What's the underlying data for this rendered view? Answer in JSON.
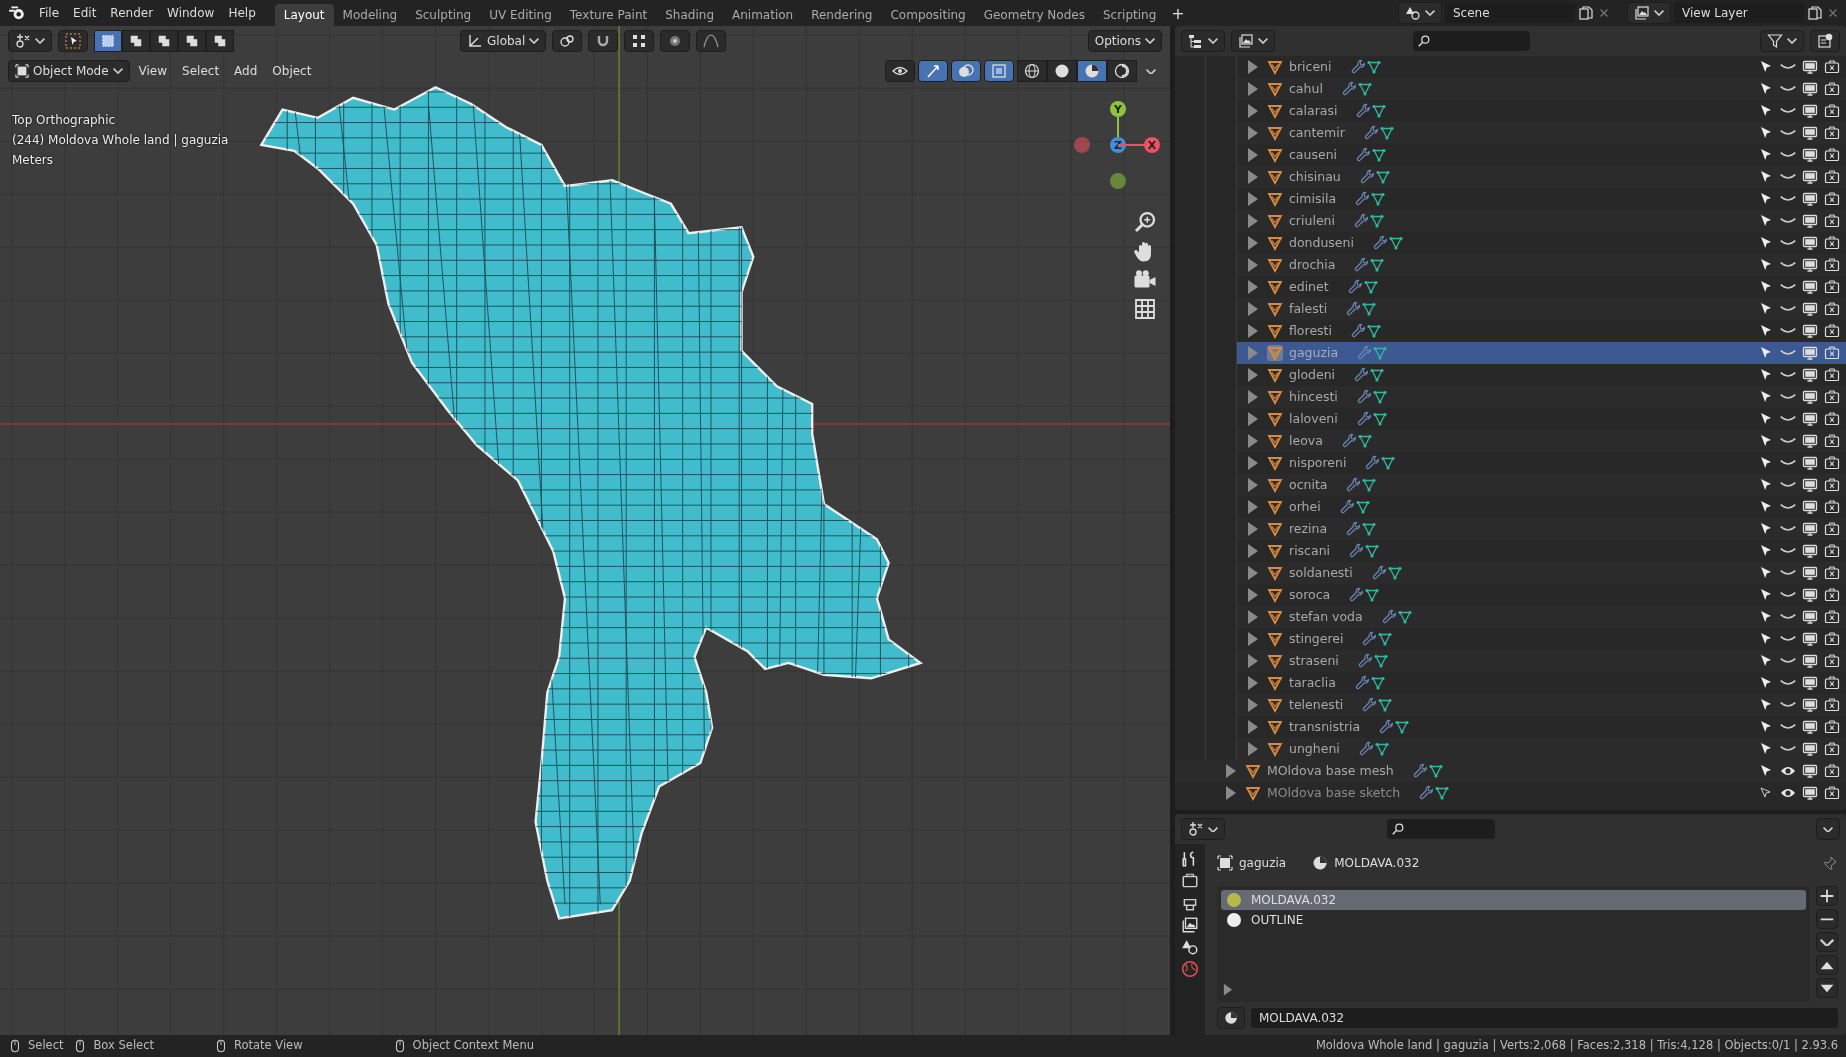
{
  "menu": [
    "File",
    "Edit",
    "Render",
    "Window",
    "Help"
  ],
  "workspaces": [
    {
      "label": "Layout",
      "selected": true
    },
    {
      "label": "Modeling",
      "selected": false
    },
    {
      "label": "Sculpting",
      "selected": false
    },
    {
      "label": "UV Editing",
      "selected": false
    },
    {
      "label": "Texture Paint",
      "selected": false
    },
    {
      "label": "Shading",
      "selected": false
    },
    {
      "label": "Animation",
      "selected": false
    },
    {
      "label": "Rendering",
      "selected": false
    },
    {
      "label": "Compositing",
      "selected": false
    },
    {
      "label": "Geometry Nodes",
      "selected": false
    },
    {
      "label": "Scripting",
      "selected": false
    }
  ],
  "add_workspace": "+",
  "scene": "Scene",
  "view_layer": "View Layer",
  "viewport": {
    "transform_orientation": "Global",
    "options": "Options",
    "mode": "Object Mode",
    "menus": [
      "View",
      "Select",
      "Add",
      "Object"
    ],
    "shading_modes": [
      {
        "kind": "wireframe",
        "selected": false
      },
      {
        "kind": "solid",
        "selected": false
      },
      {
        "kind": "material",
        "selected": true
      },
      {
        "kind": "rendered",
        "selected": false
      }
    ],
    "overlay_text": [
      "Top Orthographic",
      "(244) Moldova Whole land | gaguzia",
      "Meters"
    ],
    "gizmo_axes": [
      {
        "label": "Y",
        "color": "#8cc43d"
      },
      {
        "label": "Z",
        "color": "#3d8fe0"
      },
      {
        "label": "X",
        "color": "#f0505f"
      }
    ]
  },
  "outliner": {
    "collection_rows": [
      {
        "name": "briceni",
        "selected": false,
        "visible": false
      },
      {
        "name": "cahul",
        "selected": false,
        "visible": false
      },
      {
        "name": "calarasi",
        "selected": false,
        "visible": false
      },
      {
        "name": "cantemir",
        "selected": false,
        "visible": false
      },
      {
        "name": "causeni",
        "selected": false,
        "visible": false
      },
      {
        "name": "chisinau",
        "selected": false,
        "visible": false
      },
      {
        "name": "cimisila",
        "selected": false,
        "visible": false
      },
      {
        "name": "criuleni",
        "selected": false,
        "visible": false
      },
      {
        "name": "donduseni",
        "selected": false,
        "visible": false
      },
      {
        "name": "drochia",
        "selected": false,
        "visible": false
      },
      {
        "name": "edinet",
        "selected": false,
        "visible": false
      },
      {
        "name": "falesti",
        "selected": false,
        "visible": false
      },
      {
        "name": "floresti",
        "selected": false,
        "visible": false
      },
      {
        "name": "gaguzia",
        "selected": true,
        "visible": false
      },
      {
        "name": "glodeni",
        "selected": false,
        "visible": false
      },
      {
        "name": "hincesti",
        "selected": false,
        "visible": false
      },
      {
        "name": "laloveni",
        "selected": false,
        "visible": false
      },
      {
        "name": "leova",
        "selected": false,
        "visible": false
      },
      {
        "name": "nisporeni",
        "selected": false,
        "visible": false
      },
      {
        "name": "ocnita",
        "selected": false,
        "visible": false
      },
      {
        "name": "orhei",
        "selected": false,
        "visible": false
      },
      {
        "name": "rezina",
        "selected": false,
        "visible": false
      },
      {
        "name": "riscani",
        "selected": false,
        "visible": false
      },
      {
        "name": "soldanesti",
        "selected": false,
        "visible": false
      },
      {
        "name": "soroca",
        "selected": false,
        "visible": false
      },
      {
        "name": "stefan voda",
        "selected": false,
        "visible": false
      },
      {
        "name": "stingerei",
        "selected": false,
        "visible": false
      },
      {
        "name": "straseni",
        "selected": false,
        "visible": false
      },
      {
        "name": "taraclia",
        "selected": false,
        "visible": false
      },
      {
        "name": "telenesti",
        "selected": false,
        "visible": false
      },
      {
        "name": "transnistria",
        "selected": false,
        "visible": false
      },
      {
        "name": "ungheni",
        "selected": false,
        "visible": false
      }
    ],
    "top_rows": [
      {
        "name": "MOldova base mesh",
        "selected": false,
        "visible": true,
        "selectable": true
      },
      {
        "name": "MOldova base sketch",
        "selected": false,
        "visible": true,
        "selectable": false
      }
    ]
  },
  "properties": {
    "object": "gaguzia",
    "material": "MOLDAVA.032",
    "slots": [
      {
        "name": "MOLDAVA.032",
        "selected": true,
        "color": "#b8b84a"
      },
      {
        "name": "OUTLINE",
        "selected": false,
        "color": "#eeeeee"
      }
    ],
    "material_field": "MOLDAVA.032"
  },
  "status_bar": {
    "hints": [
      "Select",
      "Box Select",
      "Rotate View",
      "Object Context Menu"
    ],
    "stats": "Moldova Whole land | gaguzia | Verts:2,068 | Faces:2,318 | Tris:4,128 | Objects:0/1 | 2.93.6"
  }
}
